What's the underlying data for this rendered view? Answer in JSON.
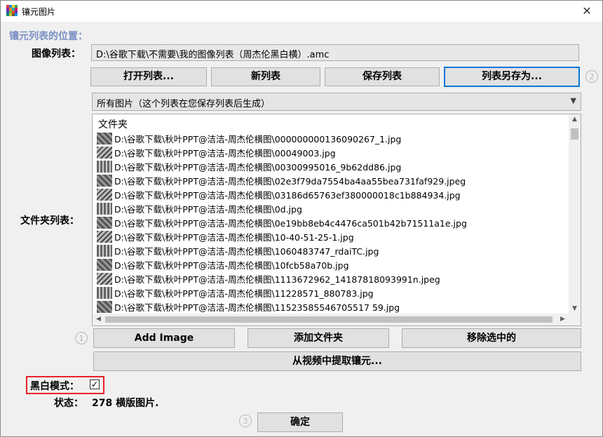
{
  "window": {
    "title": "镶元图片",
    "close_glyph": "✕"
  },
  "section_label": "镶元列表的位置：",
  "image_list": {
    "label": "图像列表：",
    "path": "D:\\谷歌下载\\不需要\\我的图像列表（周杰伦黑白横）.amc"
  },
  "list_buttons": {
    "open": "打开列表...",
    "new": "新列表",
    "save": "保存列表",
    "save_as": "列表另存为..."
  },
  "steps": {
    "one": "1",
    "two": "2",
    "three": "3"
  },
  "dropdown": {
    "selected": "所有图片（这个列表在您保存列表后生成）"
  },
  "folder_list": {
    "label": "文件夹列表：",
    "header": "文件夹",
    "items": [
      "D:\\谷歌下载\\秋叶PPT@洁洁-周杰伦横图\\000000000136090267_1.jpg",
      "D:\\谷歌下载\\秋叶PPT@洁洁-周杰伦横图\\00049003.jpg",
      "D:\\谷歌下载\\秋叶PPT@洁洁-周杰伦横图\\00300995016_9b62dd86.jpg",
      "D:\\谷歌下载\\秋叶PPT@洁洁-周杰伦横图\\02e3f79da7554ba4aa55bea731faf929.jpeg",
      "D:\\谷歌下载\\秋叶PPT@洁洁-周杰伦横图\\03186d65763ef380000018c1b884934.jpg",
      "D:\\谷歌下载\\秋叶PPT@洁洁-周杰伦横图\\0d.jpg",
      "D:\\谷歌下载\\秋叶PPT@洁洁-周杰伦横图\\0e19bb8eb4c4476ca501b42b71511a1e.jpg",
      "D:\\谷歌下载\\秋叶PPT@洁洁-周杰伦横图\\10-40-51-25-1.jpg",
      "D:\\谷歌下载\\秋叶PPT@洁洁-周杰伦横图\\1060483747_rdaiTC.jpg",
      "D:\\谷歌下载\\秋叶PPT@洁洁-周杰伦横图\\10fcb58a70b.jpg",
      "D:\\谷歌下载\\秋叶PPT@洁洁-周杰伦横图\\1113672962_14187818093991n.jpeg",
      "D:\\谷歌下载\\秋叶PPT@洁洁-周杰伦横图\\11228571_880783.jpg",
      "D:\\谷歌下载\\秋叶PPT@洁洁-周杰伦横图\\11523585546705517 59.jpg"
    ]
  },
  "action_buttons": {
    "add_image": "Add Image",
    "add_folder": "添加文件夹",
    "remove_selected": "移除选中的",
    "extract_video": "从视频中提取镶元..."
  },
  "bw_mode": {
    "label": "黑白模式：",
    "checked": true,
    "check_glyph": "✓"
  },
  "status": {
    "label": "状态：",
    "text": "278 横版图片."
  },
  "ok_button": "确定",
  "colors": {
    "highlight_box": "#e8232b",
    "focus": "#0078d7",
    "section_label": "#7a8fc4"
  }
}
